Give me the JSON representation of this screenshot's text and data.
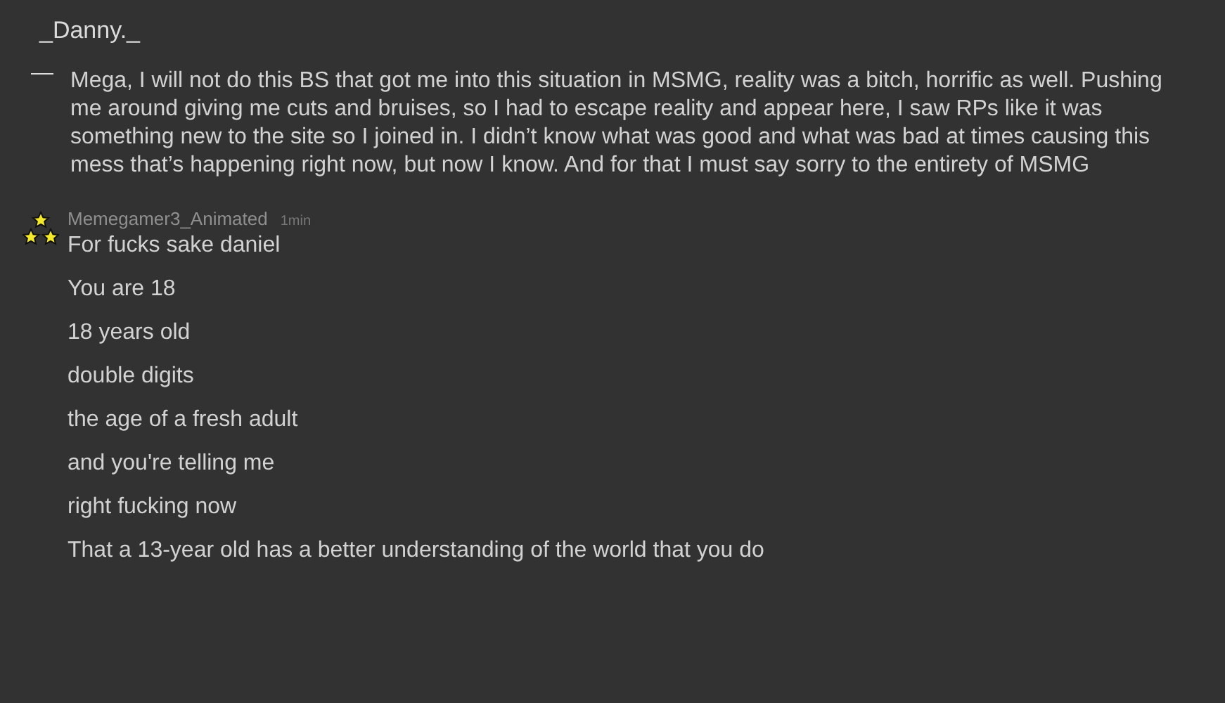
{
  "parent_comment": {
    "author": "_Danny._",
    "text": "Mega, I will not do this BS that got me into this situation in MSMG, reality was a bitch, horrific as well. Pushing me around giving me cuts and bruises, so I had to escape reality and appear here, I saw RPs like it was something new to the site so I joined in. I didn’t know what was good and what was bad at times causing this mess that’s happening right now, but now I know. And for that I must say sorry to the entirety of MSMG"
  },
  "reply": {
    "author": "Memegamer3_Animated",
    "time": "1min",
    "lines": [
      "For fucks sake daniel",
      "You are 18",
      "18 years old",
      "double digits",
      "the age of a fresh adult",
      "and you're telling me",
      "right fucking now",
      "That a 13-year old has a better understanding of the world that you do"
    ]
  }
}
